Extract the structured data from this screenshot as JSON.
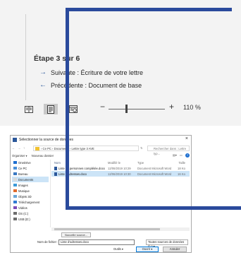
{
  "mail_merge": {
    "step": "Étape 3 sur 6",
    "next": "Suivante : Écriture de votre lettre",
    "previous": "Précédente : Document de base"
  },
  "statusbar": {
    "zoom_minus": "−",
    "zoom_plus": "+",
    "zoom_label": "110 %",
    "zoom_level_percent": 110,
    "views": [
      "read-mode-icon",
      "print-layout-icon",
      "web-layout-icon"
    ],
    "active_view": "print-layout"
  },
  "dialog": {
    "title": "Sélectionner la source de données",
    "close": "×",
    "address": {
      "back": "←",
      "forward": "→",
      "up": "↑",
      "breadcrumb": "› Ce PC › Documents › Lettre type 3 AVE",
      "refresh": "↻",
      "search_placeholder": "Rechercher dans : Lettre typ..."
    },
    "toolbar": {
      "organize": "Organiser ▾",
      "new_folder": "Nouveau dossier",
      "help": "?"
    },
    "sidebar": [
      {
        "label": "OneDrive",
        "color": "#1e6fd0"
      },
      {
        "label": "Ce PC",
        "color": "#4a90d9"
      },
      {
        "label": "Bureau",
        "color": "#3a78c2"
      },
      {
        "label": "Documents",
        "color": "#d9d9d9",
        "selected": true
      },
      {
        "label": "Images",
        "color": "#3a9ad9"
      },
      {
        "label": "Musique",
        "color": "#e06b2d"
      },
      {
        "label": "Objets 3D",
        "color": "#6aa6d8"
      },
      {
        "label": "Téléchargement",
        "color": "#2f7bd2"
      },
      {
        "label": "Vidéos",
        "color": "#7d4bb8"
      },
      {
        "label": "OS (C:)",
        "color": "#6c6c6c"
      },
      {
        "label": "USB (D:)",
        "color": "#6c6c6c"
      }
    ],
    "columns": {
      "name": "Nom",
      "date": "Modifié le",
      "type": "Type",
      "size": "Taille"
    },
    "files": [
      {
        "name": "Liste de personnes complétée.docx",
        "date": "12/06/2019 10:29",
        "type": "Document Microsoft Word",
        "size": "18 Ko"
      },
      {
        "name": "Liste d'adresses.docx",
        "date": "12/06/2019 10:30",
        "type": "Document Microsoft Word",
        "size": "16 Ko",
        "selected": true
      }
    ],
    "footer": {
      "new_source": "Nouvelle source...",
      "filename_label": "Nom de fichier :",
      "filename_value": "Liste d'adresses.docx",
      "type_filter": "Toutes sources de données (*.o ▾",
      "tools": "Outils ▾",
      "open": "Ouvrir ▾",
      "cancel": "Annuler"
    }
  },
  "colors": {
    "annotation_frame": "#2a4a9c",
    "accent": "#2b579a",
    "selection": "#cce4f7"
  }
}
